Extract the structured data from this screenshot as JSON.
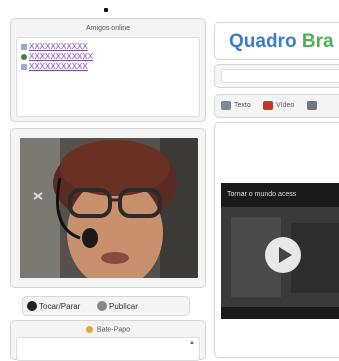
{
  "friends_panel": {
    "title": "Amigos online",
    "friends": [
      {
        "name": "XXXXXXXXXXX",
        "status": "online"
      },
      {
        "name": "XXXXXXXXXXXX",
        "status": "online"
      },
      {
        "name": "XXXXXXXXXXX",
        "status": "online"
      }
    ]
  },
  "board": {
    "title_parts": [
      {
        "text": "Quadro ",
        "color": "#3a7dc9"
      },
      {
        "text": "Bra",
        "color": "#4caf50"
      }
    ],
    "tools": [
      {
        "label": "Texto",
        "icon": "text-icon",
        "color": "#7a8a9a"
      },
      {
        "label": "Vídeo",
        "icon": "video-icon",
        "color": "#c0392b"
      },
      {
        "label": "",
        "icon": "image-icon",
        "color": "#6a7a8a"
      }
    ]
  },
  "video": {
    "caption": "Tornar o mundo acess"
  },
  "webcam_controls": {
    "play_label": "Tocar/Parar",
    "publish_label": "Publicar"
  },
  "chat": {
    "title": "Bate-Papo"
  },
  "colors": {
    "accent_blue": "#3a7dc9",
    "accent_green": "#4caf50"
  }
}
